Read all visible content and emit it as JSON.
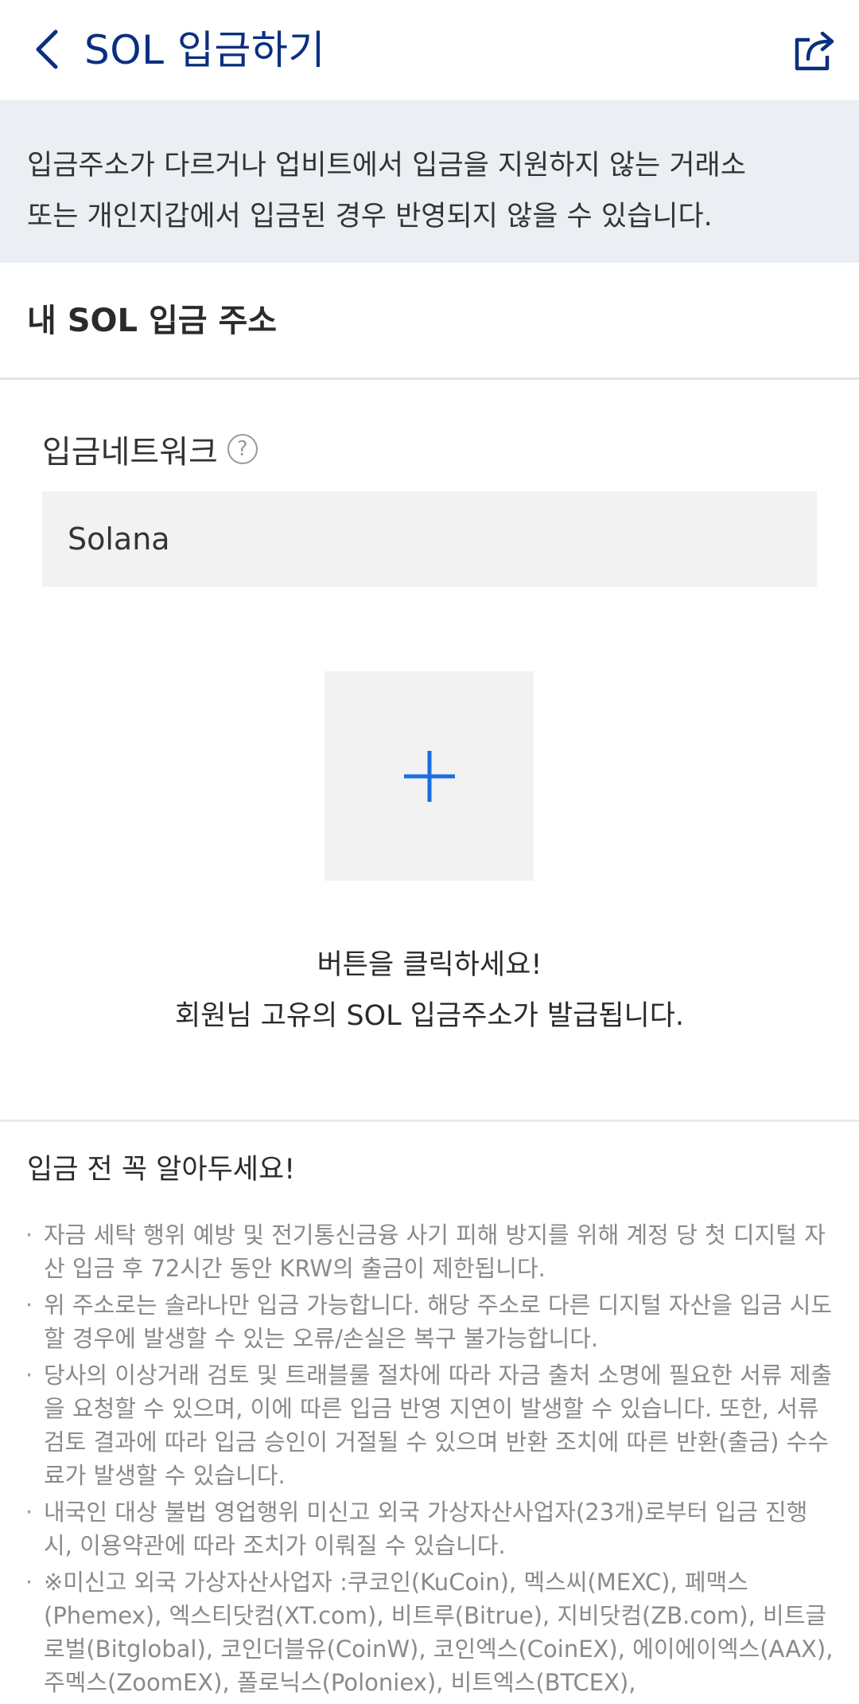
{
  "header": {
    "title": "SOL 입금하기",
    "back_icon": "chevron-left-icon",
    "share_icon": "share-icon",
    "accent_color": "#0b2f80"
  },
  "notice": {
    "line1": "입금주소가 다르거나 업비트에서 입금을 지원하지 않는 거래소",
    "line2": "또는 개인지갑에서 입금된 경우 반영되지 않을 수 있습니다."
  },
  "address_section": {
    "title": "내 SOL 입금 주소",
    "network_label": "입금네트워크",
    "help_glyph": "?",
    "network_value": "Solana",
    "generate_icon": "plus-icon",
    "plus_color": "#1a6ee0",
    "instruction_line1": "버튼을 클릭하세요!",
    "instruction_line2": "회원님 고유의 SOL 입금주소가 발급됩니다."
  },
  "info": {
    "title": "입금 전 꼭 알아두세요!",
    "bullet": "·",
    "items": [
      "자금 세탁 행위 예방 및 전기통신금융 사기 피해 방지를 위해 계정 당 첫 디지털 자산 입금 후 72시간 동안 KRW의 출금이 제한됩니다.",
      "위 주소로는 솔라나만 입금 가능합니다. 해당 주소로 다른 디지털 자산을 입금 시도할 경우에 발생할 수 있는 오류/손실은 복구 불가능합니다.",
      "당사의 이상거래 검토 및 트래블룰 절차에 따라 자금 출처 소명에 필요한 서류 제출을 요청할 수 있으며, 이에 따른 입금 반영 지연이 발생할 수 있습니다. 또한, 서류 검토 결과에 따라 입금 승인이 거절될 수 있으며 반환 조치에 따른 반환(출금) 수수료가 발생할 수 있습니다.",
      "내국인 대상 불법 영업행위 미신고 외국 가상자산사업자(23개)로부터 입금 진행 시, 이용약관에 따라 조치가 이뤄질 수 있습니다.",
      "※미신고 외국 가상자산사업자 :쿠코인(KuCoin), 멕스씨(MEXC), 페맥스(Phemex), 엑스티닷컴(XT.com), 비트루(Bitrue), 지비닷컴(ZB.com), 비트글로벌(Bitglobal), 코인더블유(CoinW), 코인엑스(CoinEX), 에이에이엑스(AAX), 주멕스(ZoomEX), 폴로닉스(Poloniex), 비트엑스(BTCEX),"
    ]
  }
}
